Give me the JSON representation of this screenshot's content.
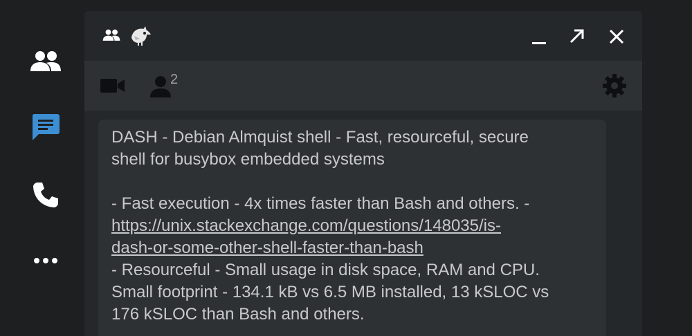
{
  "sidebar": {
    "items": [
      {
        "icon": "people-icon",
        "active": false
      },
      {
        "icon": "chat-icon",
        "active": true
      },
      {
        "icon": "phone-icon",
        "active": false
      },
      {
        "icon": "more-icon",
        "active": false
      }
    ]
  },
  "window": {
    "title_icons": [
      "people-icon",
      "bird-avatar-icon"
    ],
    "controls": [
      "minimize-icon",
      "popout-icon",
      "close-icon"
    ]
  },
  "toolbar": {
    "participants_count": "2"
  },
  "message": {
    "line1": "DASH - Debian Almquist shell - Fast, resourceful, secure",
    "line2": "shell for busybox embedded systems",
    "line3": "",
    "line4": "- Fast execution - 4x times faster than Bash and others. -",
    "link_part1": "https://unix.stackexchange.com/questions/148035/is-",
    "link_part2": "dash-or-some-other-shell-faster-than-bash",
    "line5": "- Resourceful - Small usage in disk space, RAM and CPU.",
    "line6": "Small footprint - 134.1 kB vs 6.5 MB installed, 13 kSLOC vs",
    "line7": "176 kSLOC than Bash and others."
  },
  "colors": {
    "background": "#1d1f21",
    "panel": "#25282b",
    "toolbar": "#2e3134",
    "accent_blue": "#3d8fd4",
    "icon_white": "#ffffff"
  }
}
